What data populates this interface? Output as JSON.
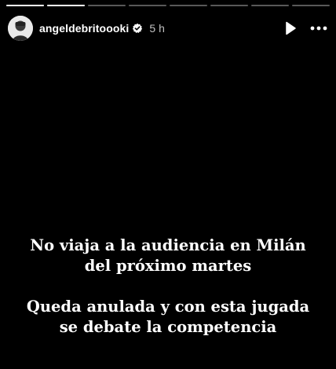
{
  "story": {
    "segment_count": 8,
    "current_segment": 1,
    "current_segment_progress": 1.0
  },
  "header": {
    "username": "angeldebritoooki",
    "time_ago": "5 h",
    "verified": true
  },
  "caption": {
    "paragraph_1": "No viaja a la audiencia en Milán\ndel próximo martes",
    "paragraph_2": "Queda anulada y con esta jugada\nse debate la competencia"
  },
  "icons": {
    "play": "play-icon",
    "more": "more-icon",
    "verified": "verified-badge-icon"
  },
  "colors": {
    "background": "#000000",
    "text": "#ffffff",
    "verified_badge": "#ffffff"
  }
}
